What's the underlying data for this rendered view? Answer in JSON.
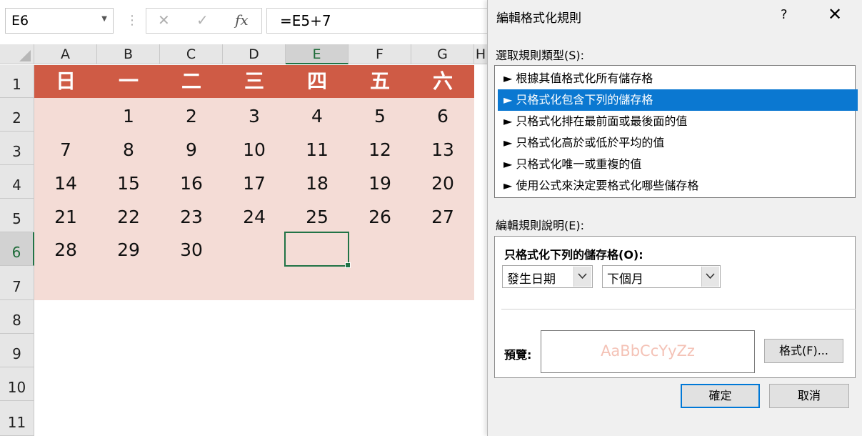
{
  "formula_bar": {
    "name_box": "E6",
    "cancel_glyph": "✕",
    "enter_glyph": "✓",
    "fx_label": "fx",
    "formula": "=E5+7"
  },
  "sheet": {
    "columns": [
      "A",
      "B",
      "C",
      "D",
      "E",
      "F",
      "G",
      "H"
    ],
    "selected_column": "E",
    "rows": [
      "1",
      "2",
      "3",
      "4",
      "5",
      "6",
      "7",
      "8",
      "9",
      "10",
      "11"
    ],
    "selected_row": "6",
    "active_cell": "E6",
    "header_days": [
      "日",
      "一",
      "二",
      "三",
      "四",
      "五",
      "六"
    ],
    "weeks": [
      [
        "",
        "1",
        "2",
        "3",
        "4",
        "5",
        "6"
      ],
      [
        "7",
        "8",
        "9",
        "10",
        "11",
        "12",
        "13"
      ],
      [
        "14",
        "15",
        "16",
        "17",
        "18",
        "19",
        "20"
      ],
      [
        "21",
        "22",
        "23",
        "24",
        "25",
        "26",
        "27"
      ],
      [
        "28",
        "29",
        "30",
        "",
        "",
        "",
        ""
      ]
    ],
    "colors": {
      "header_fill": "#cf5b45",
      "body_fill": "#f4dcd6",
      "selection": "#217346"
    }
  },
  "dialog": {
    "title": "編輯格式化規則",
    "help": "?",
    "close": "✕",
    "rule_type_label": "選取規則類型(S):",
    "rule_types": [
      "► 根據其值格式化所有儲存格",
      "► 只格式化包含下列的儲存格",
      "► 只格式化排在最前面或最後面的值",
      "► 只格式化高於或低於平均的值",
      "► 只格式化唯一或重複的值",
      "► 使用公式來決定要格式化哪些儲存格"
    ],
    "selected_rule_index": 1,
    "desc_label": "編輯規則說明(E):",
    "desc_heading": "只格式化下列的儲存格(O):",
    "combo1": "發生日期",
    "combo2": "下個月",
    "preview_label": "預覽:",
    "preview_text": "AaBbCcYyZz",
    "format_button": "格式(F)...",
    "ok_button": "確定",
    "cancel_button": "取消",
    "accent": "#0b78d1"
  }
}
